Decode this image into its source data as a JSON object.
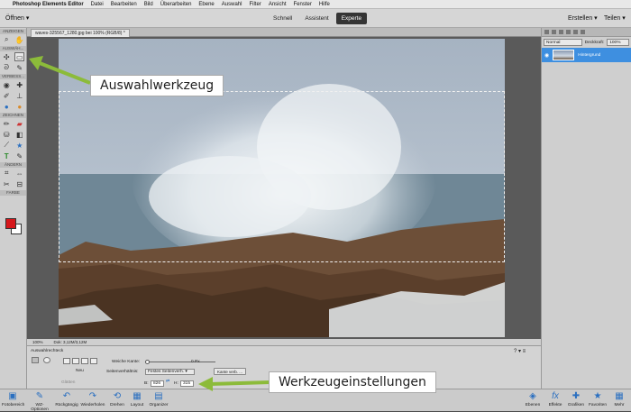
{
  "menubar": {
    "apple": "",
    "app_name": "Photoshop Elements Editor",
    "items": [
      "Datei",
      "Bearbeiten",
      "Bild",
      "Überarbeiten",
      "Ebene",
      "Auswahl",
      "Filter",
      "Ansicht",
      "Fenster",
      "Hilfe"
    ]
  },
  "topbar": {
    "open": "Öffnen ▾",
    "modes": [
      "Schnell",
      "Assistent",
      "Experte"
    ],
    "active_mode": "Experte",
    "create": "Erstellen ▾",
    "share": "Teilen ▾"
  },
  "doc_tab": {
    "label": "waves-325567_1280.jpg bei 100% (RGB/8) *"
  },
  "toolbox": {
    "sections": [
      "ANZEIGEN",
      "AUSWÄH...",
      "VERBESS...",
      "ZEICHNEN",
      "ÄNDERN",
      "FARBE"
    ],
    "foreground_color": "#d6181c",
    "background_color": "#ffffff"
  },
  "status": {
    "zoom": "100%",
    "doc": "Dok: 3,12M/3,12M"
  },
  "options": {
    "tool_name": "Auswahlrechteck",
    "new_label": "Neu",
    "smooth_label": "Glätten",
    "feather_label": "Weiche Kante:",
    "feather_value": "0 Px",
    "ratio_label": "Seitenverhältnis:",
    "ratio_value": "Festes Seitenverh. ▾",
    "refine_button": "Kante verb. ...",
    "width_label": "B:",
    "width_value": "826",
    "height_label": "H:",
    "height_value": "315"
  },
  "layers": {
    "blend_mode": "Normal",
    "opacity_label": "Deckkraft:",
    "opacity_value": "100%",
    "layer_name": "Hintergrund"
  },
  "bottom_left": [
    {
      "label": "Fotobereich",
      "icon": "photo-bin-icon"
    },
    {
      "label": "WZ-Optionen",
      "icon": "tool-options-icon"
    },
    {
      "label": "Rückgängig",
      "icon": "undo-icon"
    },
    {
      "label": "Wiederholen",
      "icon": "redo-icon"
    },
    {
      "label": "Drehen",
      "icon": "rotate-icon"
    },
    {
      "label": "Layout",
      "icon": "layout-icon"
    },
    {
      "label": "Organizer",
      "icon": "organizer-icon"
    }
  ],
  "bottom_right": [
    {
      "label": "Ebenen",
      "icon": "layers-icon"
    },
    {
      "label": "Effekte",
      "icon": "fx-icon"
    },
    {
      "label": "Grafiken",
      "icon": "graphics-icon"
    },
    {
      "label": "Favoriten",
      "icon": "favorites-icon"
    },
    {
      "label": "Mehr",
      "icon": "more-icon"
    }
  ],
  "callouts": {
    "top": "Auswahlwerkzeug",
    "bottom": "Werkzeugeinstellungen",
    "arrow_color": "#8cbb3a"
  }
}
